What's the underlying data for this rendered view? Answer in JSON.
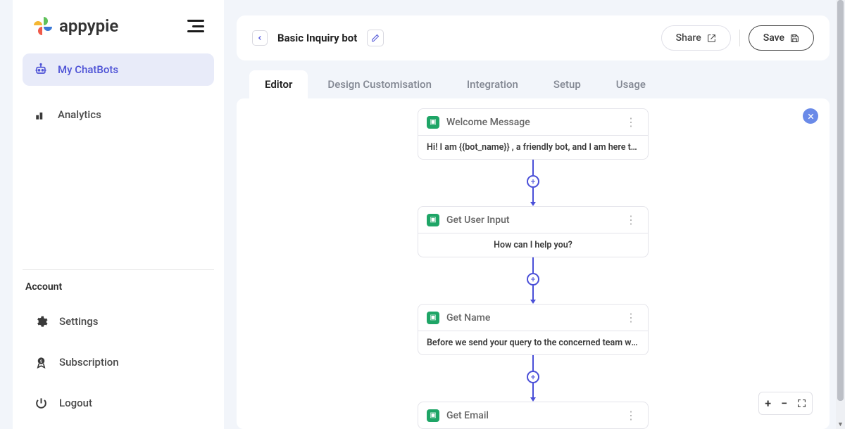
{
  "brand": "appypie",
  "sidebar": {
    "nav": [
      {
        "label": "My ChatBots",
        "active": true
      },
      {
        "label": "Analytics",
        "active": false
      }
    ],
    "account_heading": "Account",
    "account": [
      {
        "label": "Settings"
      },
      {
        "label": "Subscription"
      },
      {
        "label": "Logout"
      }
    ]
  },
  "header": {
    "title": "Basic Inquiry bot",
    "share": "Share",
    "save": "Save"
  },
  "tabs": [
    {
      "label": "Editor",
      "active": true
    },
    {
      "label": "Design Customisation",
      "active": false
    },
    {
      "label": "Integration",
      "active": false
    },
    {
      "label": "Setup",
      "active": false
    },
    {
      "label": "Usage",
      "active": false
    }
  ],
  "flow": [
    {
      "title": "Welcome Message",
      "body": "Hi! I am {{bot_name}} , a friendly bot, and I am here to a...",
      "center": false
    },
    {
      "title": "Get User Input",
      "body": "How can I help you?",
      "center": true
    },
    {
      "title": "Get Name",
      "body": "Before we send your query to the concerned team we'd a...",
      "center": false
    },
    {
      "title": "Get Email",
      "body": "",
      "center": false
    }
  ]
}
